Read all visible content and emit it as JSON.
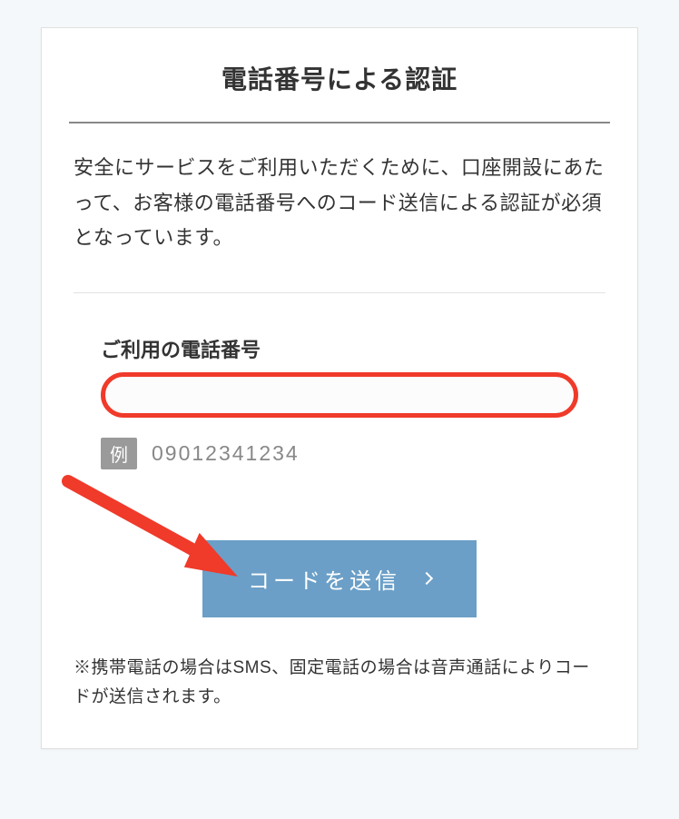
{
  "card": {
    "title": "電話番号による認証",
    "description": "安全にサービスをご利用いただくために、口座開設にあたって、お客様の電話番号へのコード送信による認証が必須となっています。"
  },
  "form": {
    "phone_label": "ご利用の電話番号",
    "phone_value": "",
    "example_badge": "例",
    "example_text": "09012341234"
  },
  "button": {
    "send_label": "コードを送信"
  },
  "footer": {
    "note": "※携帯電話の場合はSMS、固定電話の場合は音声通話によりコードが送信されます。"
  },
  "colors": {
    "highlight": "#f03a2a",
    "button_bg": "#6b9fc7"
  }
}
